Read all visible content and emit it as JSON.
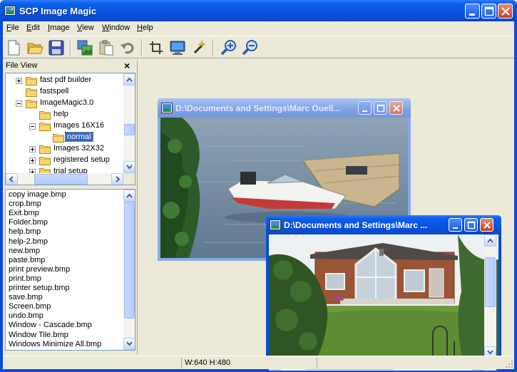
{
  "app": {
    "title": "SCP Image Magic"
  },
  "menu": [
    {
      "label": "File",
      "key": "F",
      "rest": "ile"
    },
    {
      "label": "Edit",
      "key": "E",
      "rest": "dit"
    },
    {
      "label": "Image",
      "key": "I",
      "rest": "mage"
    },
    {
      "label": "View",
      "key": "V",
      "rest": "iew"
    },
    {
      "label": "Window",
      "key": "W",
      "rest": "indow"
    },
    {
      "label": "Help",
      "key": "H",
      "rest": "elp"
    }
  ],
  "toolbar": [
    {
      "name": "new-file-button",
      "icon": "new-file-icon"
    },
    {
      "name": "open-folder-button",
      "icon": "open-folder-icon"
    },
    {
      "name": "save-button",
      "icon": "floppy-disk-icon"
    },
    {
      "name": "copy-image-button",
      "icon": "copy-image-icon"
    },
    {
      "name": "paste-button",
      "icon": "clipboard-icon"
    },
    {
      "name": "undo-button",
      "icon": "undo-arrow-icon"
    },
    {
      "name": "crop-button",
      "icon": "crop-icon"
    },
    {
      "name": "screen-button",
      "icon": "monitor-icon"
    },
    {
      "name": "magic-wand-button",
      "icon": "magic-wand-icon"
    },
    {
      "name": "zoom-in-button",
      "icon": "zoom-in-icon"
    },
    {
      "name": "zoom-out-button",
      "icon": "zoom-out-icon"
    }
  ],
  "file_view": {
    "title": "File View",
    "close": "×",
    "tree": [
      {
        "label": "fast pdf builder",
        "level": 2,
        "expander": "plus"
      },
      {
        "label": "fastspell",
        "level": 2,
        "expander": "none"
      },
      {
        "label": "ImageMagic3.0",
        "level": 2,
        "expander": "minus"
      },
      {
        "label": "help",
        "level": 3,
        "expander": "none"
      },
      {
        "label": "Images 16X16",
        "level": 3,
        "expander": "minus"
      },
      {
        "label": "normal",
        "level": 4,
        "expander": "none",
        "selected": true
      },
      {
        "label": "Images 32X32",
        "level": 3,
        "expander": "plus"
      },
      {
        "label": "registered setup",
        "level": 3,
        "expander": "plus"
      },
      {
        "label": "trial setup",
        "level": 3,
        "expander": "plus"
      }
    ],
    "files": [
      "copy image.bmp",
      "crop.bmp",
      "Exit.bmp",
      "Folder.bmp",
      "help.bmp",
      "help-2.bmp",
      "new.bmp",
      "paste.bmp",
      "print preview.bmp",
      "print.bmp",
      "printer setup.bmp",
      "save.bmp",
      "Screen.bmp",
      "undo.bmp",
      "Window - Cascade.bmp",
      "Window Tile.bmp",
      "Windows Minimize All.bmp"
    ]
  },
  "windows": [
    {
      "title": "D:\\Documents and Settings\\Marc Ouell...",
      "state": "inactive"
    },
    {
      "title": "D:\\Documents and Settings\\Marc ...",
      "state": "active"
    }
  ],
  "status": {
    "dimensions": "W:640  H:480"
  },
  "colors": {
    "titlebar": "#0853DE",
    "selection": "#316AC5",
    "face": "#ECE9D8"
  }
}
